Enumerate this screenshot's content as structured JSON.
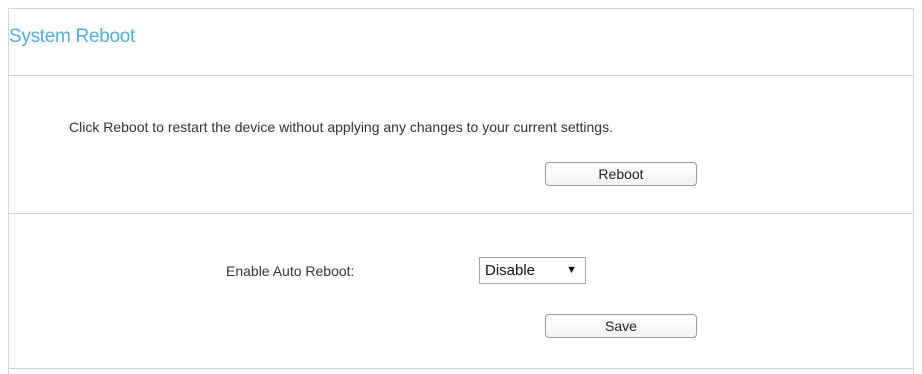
{
  "header": {
    "title": "System Reboot"
  },
  "reboot_section": {
    "description": "Click Reboot to restart the device without applying any changes to your current settings.",
    "reboot_label": "Reboot"
  },
  "auto_reboot_section": {
    "label": "Enable Auto Reboot:",
    "select_value": "Disable",
    "save_label": "Save"
  },
  "icons": {
    "dropdown": "chevron-down-icon"
  },
  "colors": {
    "title": "#4faee0",
    "border": "#d4d4d4"
  }
}
